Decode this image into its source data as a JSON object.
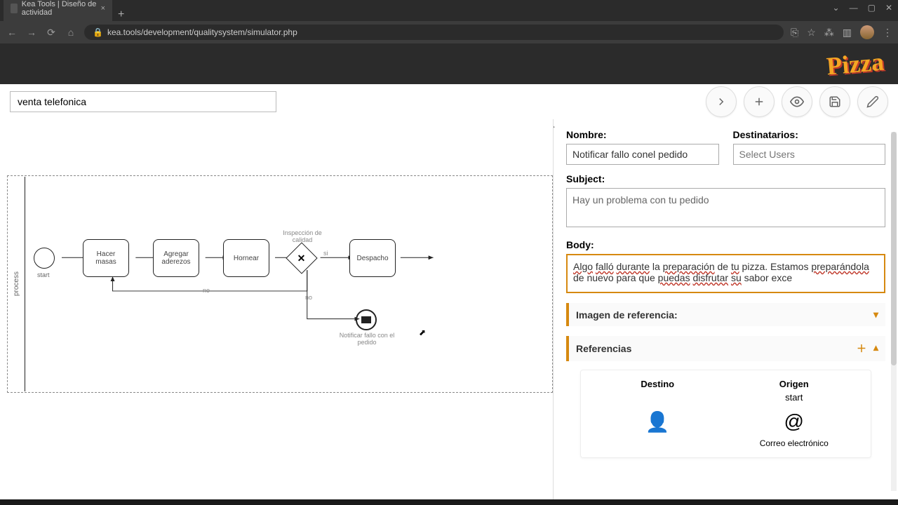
{
  "browser": {
    "tab_title": "Kea Tools | Diseño de actividad",
    "url": "kea.tools/development/qualitysystem/simulator.php"
  },
  "header": {
    "logo_text": "Pizza"
  },
  "toolbar": {
    "process_name": "venta telefonica"
  },
  "diagram": {
    "lane": "process",
    "start_label": "start",
    "nodes": {
      "n1": "Hacer masas",
      "n2": "Agregar aderezos",
      "n3": "Hornear",
      "n4": "Despacho"
    },
    "gateway_label": "Inspección de calidad",
    "edge_yes": "si",
    "edge_no": "no",
    "msg_event_label": "Notificar fallo con el pedido"
  },
  "panel": {
    "nombre_label": "Nombre:",
    "nombre_value": "Notificar fallo conel pedido",
    "dest_label": "Destinatarios:",
    "dest_placeholder": "Select Users",
    "subject_label": "Subject:",
    "subject_value": "Hay un problema con tu pedido",
    "body_label": "Body:",
    "body_spell": {
      "w1": "Algo",
      "w2": "falló",
      "w3": "durante",
      "t1": " la ",
      "w4": "preparación",
      "t2": " de ",
      "w5": "tu",
      "t3": " pizza. Estamos ",
      "w6": "preparándola",
      "t4": " de nuevo para que ",
      "w7": "puedas",
      "w8": "disfrutar",
      "w9": "su",
      "t5": " sabor exce"
    },
    "section_img": "Imagen de referencia:",
    "section_ref": "Referencias",
    "ref": {
      "destino": "Destino",
      "origen": "Origen",
      "origen_sub": "start",
      "email": "Correo electrónico"
    }
  }
}
